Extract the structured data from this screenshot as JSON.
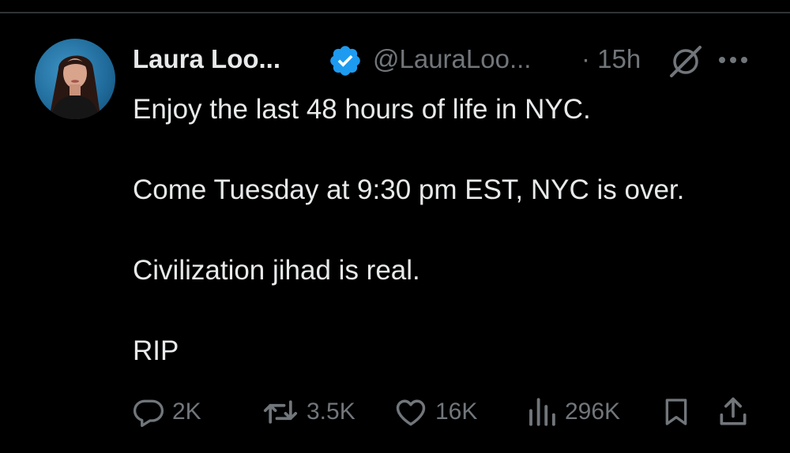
{
  "colors": {
    "background": "#000000",
    "text_primary": "#e7e9ea",
    "text_secondary": "#71767b",
    "verified_badge": "#1d9bf0",
    "divider": "#2f3336"
  },
  "tweet": {
    "author": {
      "display_name": "Laura Loo...",
      "handle": "@LauraLoo...",
      "verified": true,
      "avatar_icon": "profile-photo"
    },
    "time_ago": "· 15h",
    "paragraphs": [
      "Enjoy the last 48 hours of life in NYC.",
      "Come Tuesday at 9:30 pm EST, NYC is over.",
      "Civilization jihad is real.",
      "RIP"
    ],
    "header_icons": [
      "grok-icon",
      "more-options-icon"
    ],
    "actions": {
      "replies": "2K",
      "reposts": "3.5K",
      "likes": "16K",
      "views": "296K"
    },
    "action_icons": [
      "reply-icon",
      "repost-icon",
      "like-icon",
      "views-icon",
      "bookmark-icon",
      "share-icon"
    ]
  }
}
